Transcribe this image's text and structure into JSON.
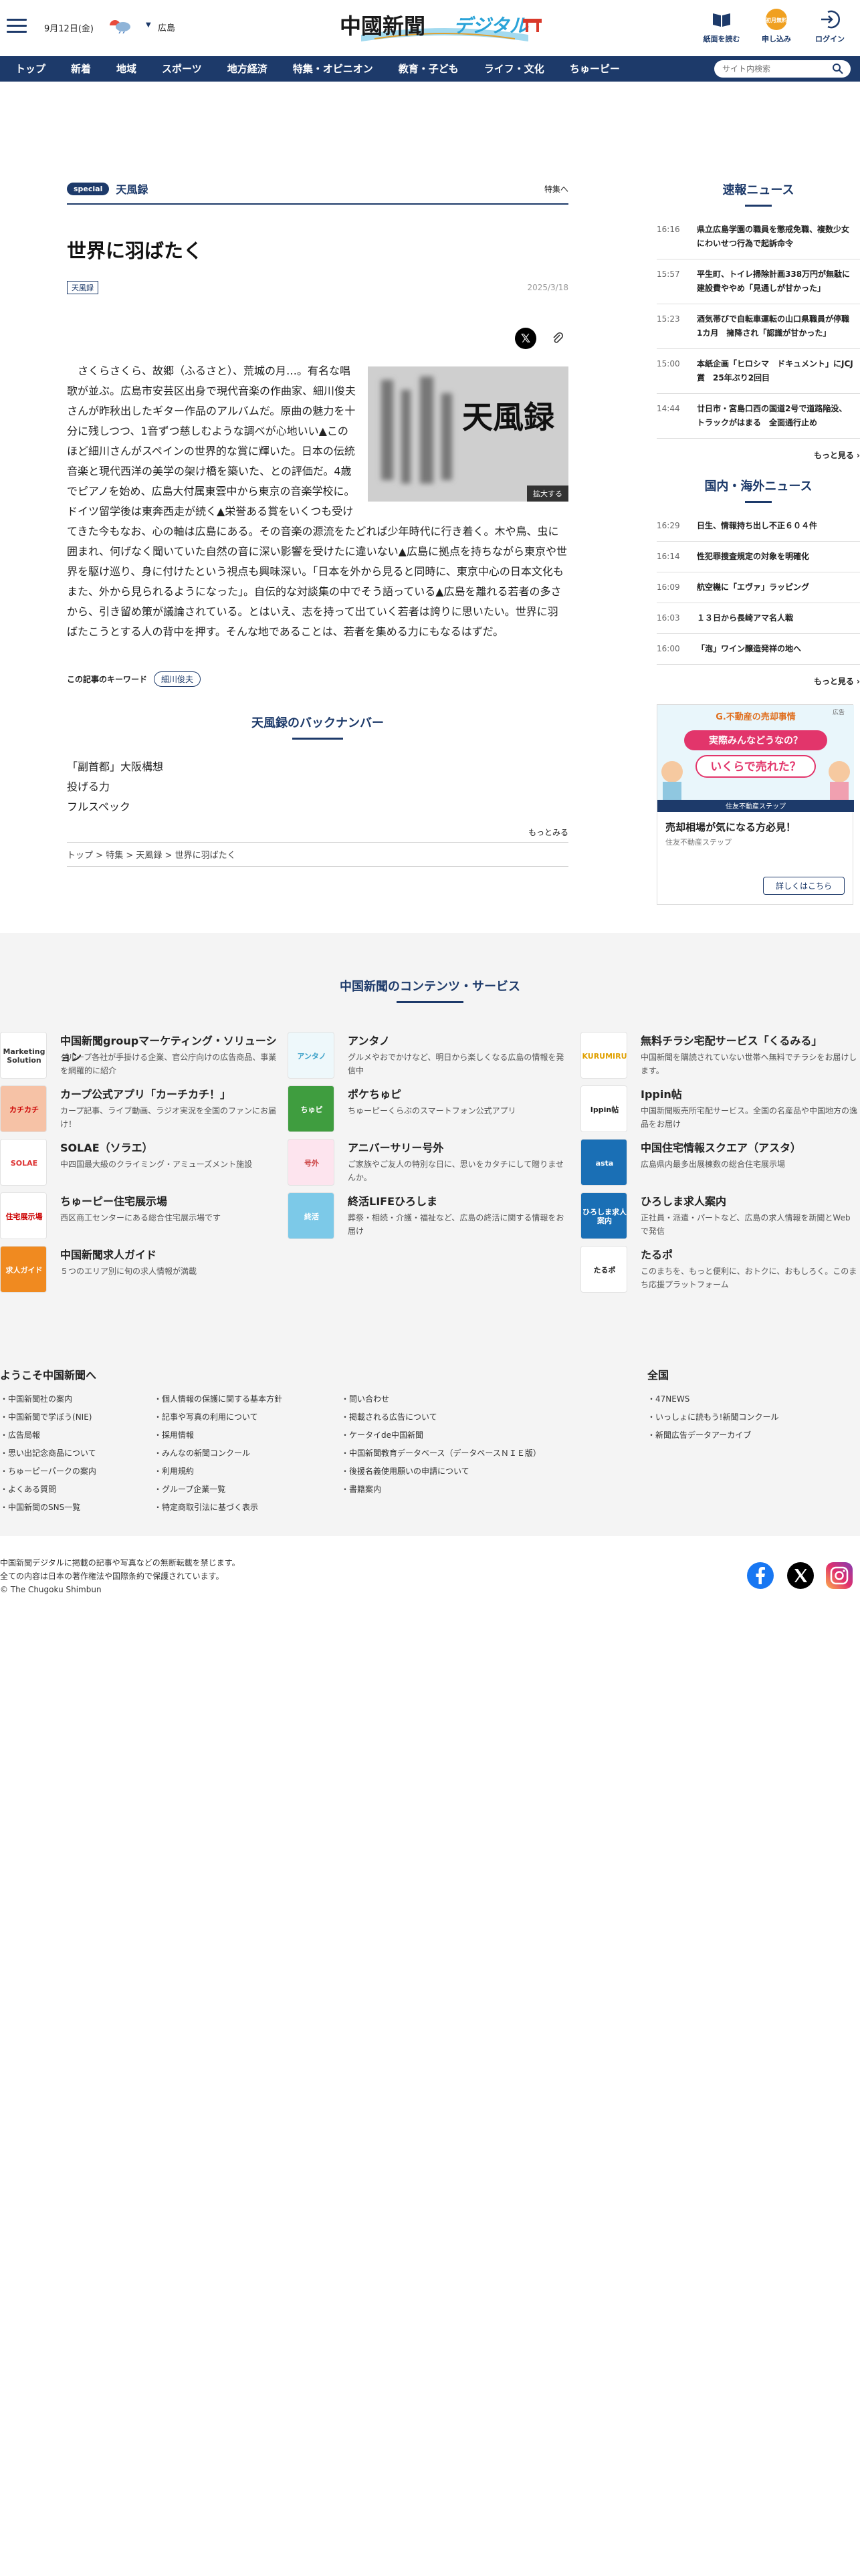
{
  "header": {
    "date": "9月12日(金)",
    "region": "広島",
    "logo_text": "中國新聞",
    "logo_sub": "デジタル",
    "buttons": [
      "紙面を読む",
      "申し込み",
      "ログイン"
    ]
  },
  "nav": {
    "items": [
      "トップ",
      "新着",
      "地域",
      "スポーツ",
      "地方経済",
      "特集・オピニオン",
      "教育・子ども",
      "ライフ・文化",
      "ちゅーピー"
    ],
    "search_placeholder": "サイト内検索"
  },
  "article": {
    "badge": "special",
    "category": "天風録",
    "category_link": "特集へ",
    "title": "世界に羽ばたく",
    "tag": "天風録",
    "date": "2025/3/18",
    "figure_text": "天風録",
    "figure_caption": "拡大する",
    "body": "さくらさくら、故郷（ふるさと）、荒城の月…。有名な唱歌が並ぶ。広島市安芸区出身で現代音楽の作曲家、細川俊夫さんが昨秋出したギター作品のアルバムだ。原曲の魅力を十分に残しつつ、1音ずつ慈しむような調べが心地いい▲このほど細川さんがスペインの世界的な賞に輝いた。日本の伝統音楽と現代西洋の美学の架け橋を築いた、との評価だ。4歳でピアノを始め、広島大付属東雲中から東京の音楽学校に。ドイツ留学後は東奔西走が続く▲栄誉ある賞をいくつも受けてきた今もなお、心の軸は広島にある。その音楽の源流をたどれば少年時代に行き着く。木や鳥、虫に囲まれ、何げなく聞いていた自然の音に深い影響を受けたに違いない▲広島に拠点を持ちながら東京や世界を駆け巡り、身に付けたという視点も興味深い。「日本を外から見ると同時に、東京中心の日本文化もまた、外から見られるようになった」。自伝的な対談集の中でそう語っている▲広島を離れる若者の多さから、引き留め策が議論されている。とはいえ、志を持って出ていく若者は誇りに思いたい。世界に羽ばたこうとする人の背中を押す。そんな地であることは、若者を集める力にもなるはずだ。",
    "keyword_label": "この記事のキーワード",
    "keyword": "細川俊夫",
    "backnumber_title": "天風録のバックナンバー",
    "backnumbers": [
      "「副首都」大阪構想",
      "投げる力",
      "フルスペック"
    ],
    "more": "もっとみる",
    "breadcrumb": [
      "トップ",
      "特集",
      "天風録",
      "世界に羽ばたく"
    ]
  },
  "sidebar": {
    "breaking_title": "速報ニュース",
    "breaking": [
      {
        "time": "16:16",
        "text": "県立広島学園の職員を懲戒免職、複数少女にわいせつ行為で起訴命令"
      },
      {
        "time": "15:57",
        "text": "平生町、トイレ掃除計画338万円が無駄に　建設費ややめ「見通しが甘かった」"
      },
      {
        "time": "15:23",
        "text": "酒気帯びで自転車運転の山口県職員が停職1カ月　擁降され「認識が甘かった」"
      },
      {
        "time": "15:00",
        "text": "本紙企画「ヒロシマ　ドキュメント」にJCJ賞　25年ぶり2回目"
      },
      {
        "time": "14:44",
        "text": "廿日市・宮島口西の国道2号で道路陥没、トラックがはまる　全面通行止め"
      }
    ],
    "breaking_more": "もっと見る",
    "domestic_title": "国内・海外ニュース",
    "domestic": [
      {
        "time": "16:29",
        "text": "日生、情報持ち出し不正６０４件"
      },
      {
        "time": "16:14",
        "text": "性犯罪捜査規定の対象を明確化"
      },
      {
        "time": "16:09",
        "text": "航空機に「エヴァ」ラッピング"
      },
      {
        "time": "16:03",
        "text": "１３日から長崎アマ名人戦"
      },
      {
        "time": "16:00",
        "text": "「泡」ワイン醸造発祥の地へ"
      }
    ],
    "domestic_more": "もっと見る",
    "ad": {
      "label": "広告",
      "brand": "G.不動産の売却事情",
      "line1": "実際みんなどうなの？",
      "line2": "いくらで売れた？",
      "strip": "住友不動産ステップ",
      "title": "売却相場が気になる方必見！",
      "sub": "住友不動産ステップ",
      "button": "詳しくはこちら"
    }
  },
  "footer": {
    "services_title": "中国新聞のコンテンツ・サービス",
    "services": [
      {
        "name": "中国新聞groupマーケティング・ソリューション",
        "desc": "グループ各社が手掛ける企業、官公庁向けの広告商品、事業を網羅的に紹介",
        "img": "Marketing Solution",
        "color": "#ffffff",
        "fg": "#333"
      },
      {
        "name": "アンタノ",
        "desc": "グルメやおでかけなど、明日から楽しくなる広島の情報を発信中",
        "img": "アンタノ",
        "color": "#eef8fb",
        "fg": "#3aa0c8"
      },
      {
        "name": "無料チラシ宅配サービス「くるみる」",
        "desc": "中国新聞を購読されていない世帯へ無料でチラシをお届けします。",
        "img": "KURUMIRU",
        "color": "#ffffff",
        "fg": "#e0a000"
      },
      {
        "name": "カープ公式アプリ「カーチカチ！」",
        "desc": "カープ記事、ライブ動画、ラジオ実況を全国のファンにお届け！",
        "img": "カチカチ",
        "color": "#f6c2a6",
        "fg": "#c00"
      },
      {
        "name": "ポケちゅピ",
        "desc": "ちゅーピーくらぶのスマートフォン公式アプリ",
        "img": "ちゅピ",
        "color": "#3f9d3f",
        "fg": "#fff"
      },
      {
        "name": "Ippin帖",
        "desc": "中国新聞販売所宅配サービス。全国の名産品や中国地方の逸品をお届け",
        "img": "Ippin帖",
        "color": "#ffffff",
        "fg": "#222"
      },
      {
        "name": "SOLAE（ソラエ）",
        "desc": "中四国最大級のクライミング・アミューズメント施設",
        "img": "SOLAE",
        "color": "#ffffff",
        "fg": "#d33"
      },
      {
        "name": "アニバーサリー号外",
        "desc": "ご家族やご友人の特別な日に、思いをカタチにして贈りませんか。",
        "img": "号外",
        "color": "#fde4ee",
        "fg": "#c44"
      },
      {
        "name": "中国住宅情報スクエア（アスタ）",
        "desc": "広島県内最多出展棟数の総合住宅展示場",
        "img": "asta",
        "color": "#1a6fb5",
        "fg": "#fff"
      },
      {
        "name": "ちゅーピー住宅展示場",
        "desc": "西区商工センターにある総合住宅展示場です",
        "img": "住宅展示場",
        "color": "#ffffff",
        "fg": "#c00"
      },
      {
        "name": "終活LIFEひろしま",
        "desc": "葬祭・相続・介護・福祉など、広島の終活に関する情報をお届け",
        "img": "終活",
        "color": "#7cc9e8",
        "fg": "#fff"
      },
      {
        "name": "ひろしま求人案内",
        "desc": "正社員・派遣・パートなど、広島の求人情報を新聞とWebで発信",
        "img": "ひろしま求人案内",
        "color": "#1a6fb5",
        "fg": "#fff"
      },
      {
        "name": "中国新聞求人ガイド",
        "desc": "５つのエリア別に旬の求人情報が満載",
        "img": "求人ガイド",
        "color": "#f08a20",
        "fg": "#fff"
      },
      {
        "name": "",
        "desc": "",
        "img": "",
        "color": "",
        "fg": ""
      },
      {
        "name": "たるポ",
        "desc": "このまちを、もっと便利に、おトクに、おもしろく。このまち応援プラットフォーム",
        "img": "たるポ",
        "color": "#ffffff",
        "fg": "#222"
      }
    ],
    "welcome_title": "ようこそ中国新聞へ",
    "links_col1": [
      "中国新聞社の案内",
      "中国新聞で学ぼう(NIE)",
      "広告局報",
      "思い出記念商品について",
      "ちゅーピーパークの案内",
      "よくある質問",
      "中国新聞のSNS一覧"
    ],
    "links_col2": [
      "個人情報の保護に関する基本方針",
      "記事や写真の利用について",
      "採用情報",
      "みんなの新聞コンクール",
      "利用規約",
      "グループ企業一覧",
      "特定商取引法に基づく表示"
    ],
    "links_col3": [
      "問い合わせ",
      "掲載される広告について",
      "ケータイde中国新聞",
      "中国新聞教育データベース（データベースＮＩＥ版）",
      "後援名義使用願いの申請について",
      "書籍案内"
    ],
    "zenkoku_title": "全国",
    "links_col4": [
      "47NEWS",
      "いっしょに読もう!新聞コンクール",
      "新聞広告データアーカイブ"
    ],
    "copyright": [
      "中国新聞デジタルに掲載の記事や写真などの無断転載を禁じます。",
      "全ての内容は日本の著作権法や国際条約で保護されています。",
      "© The Chugoku Shimbun"
    ]
  }
}
